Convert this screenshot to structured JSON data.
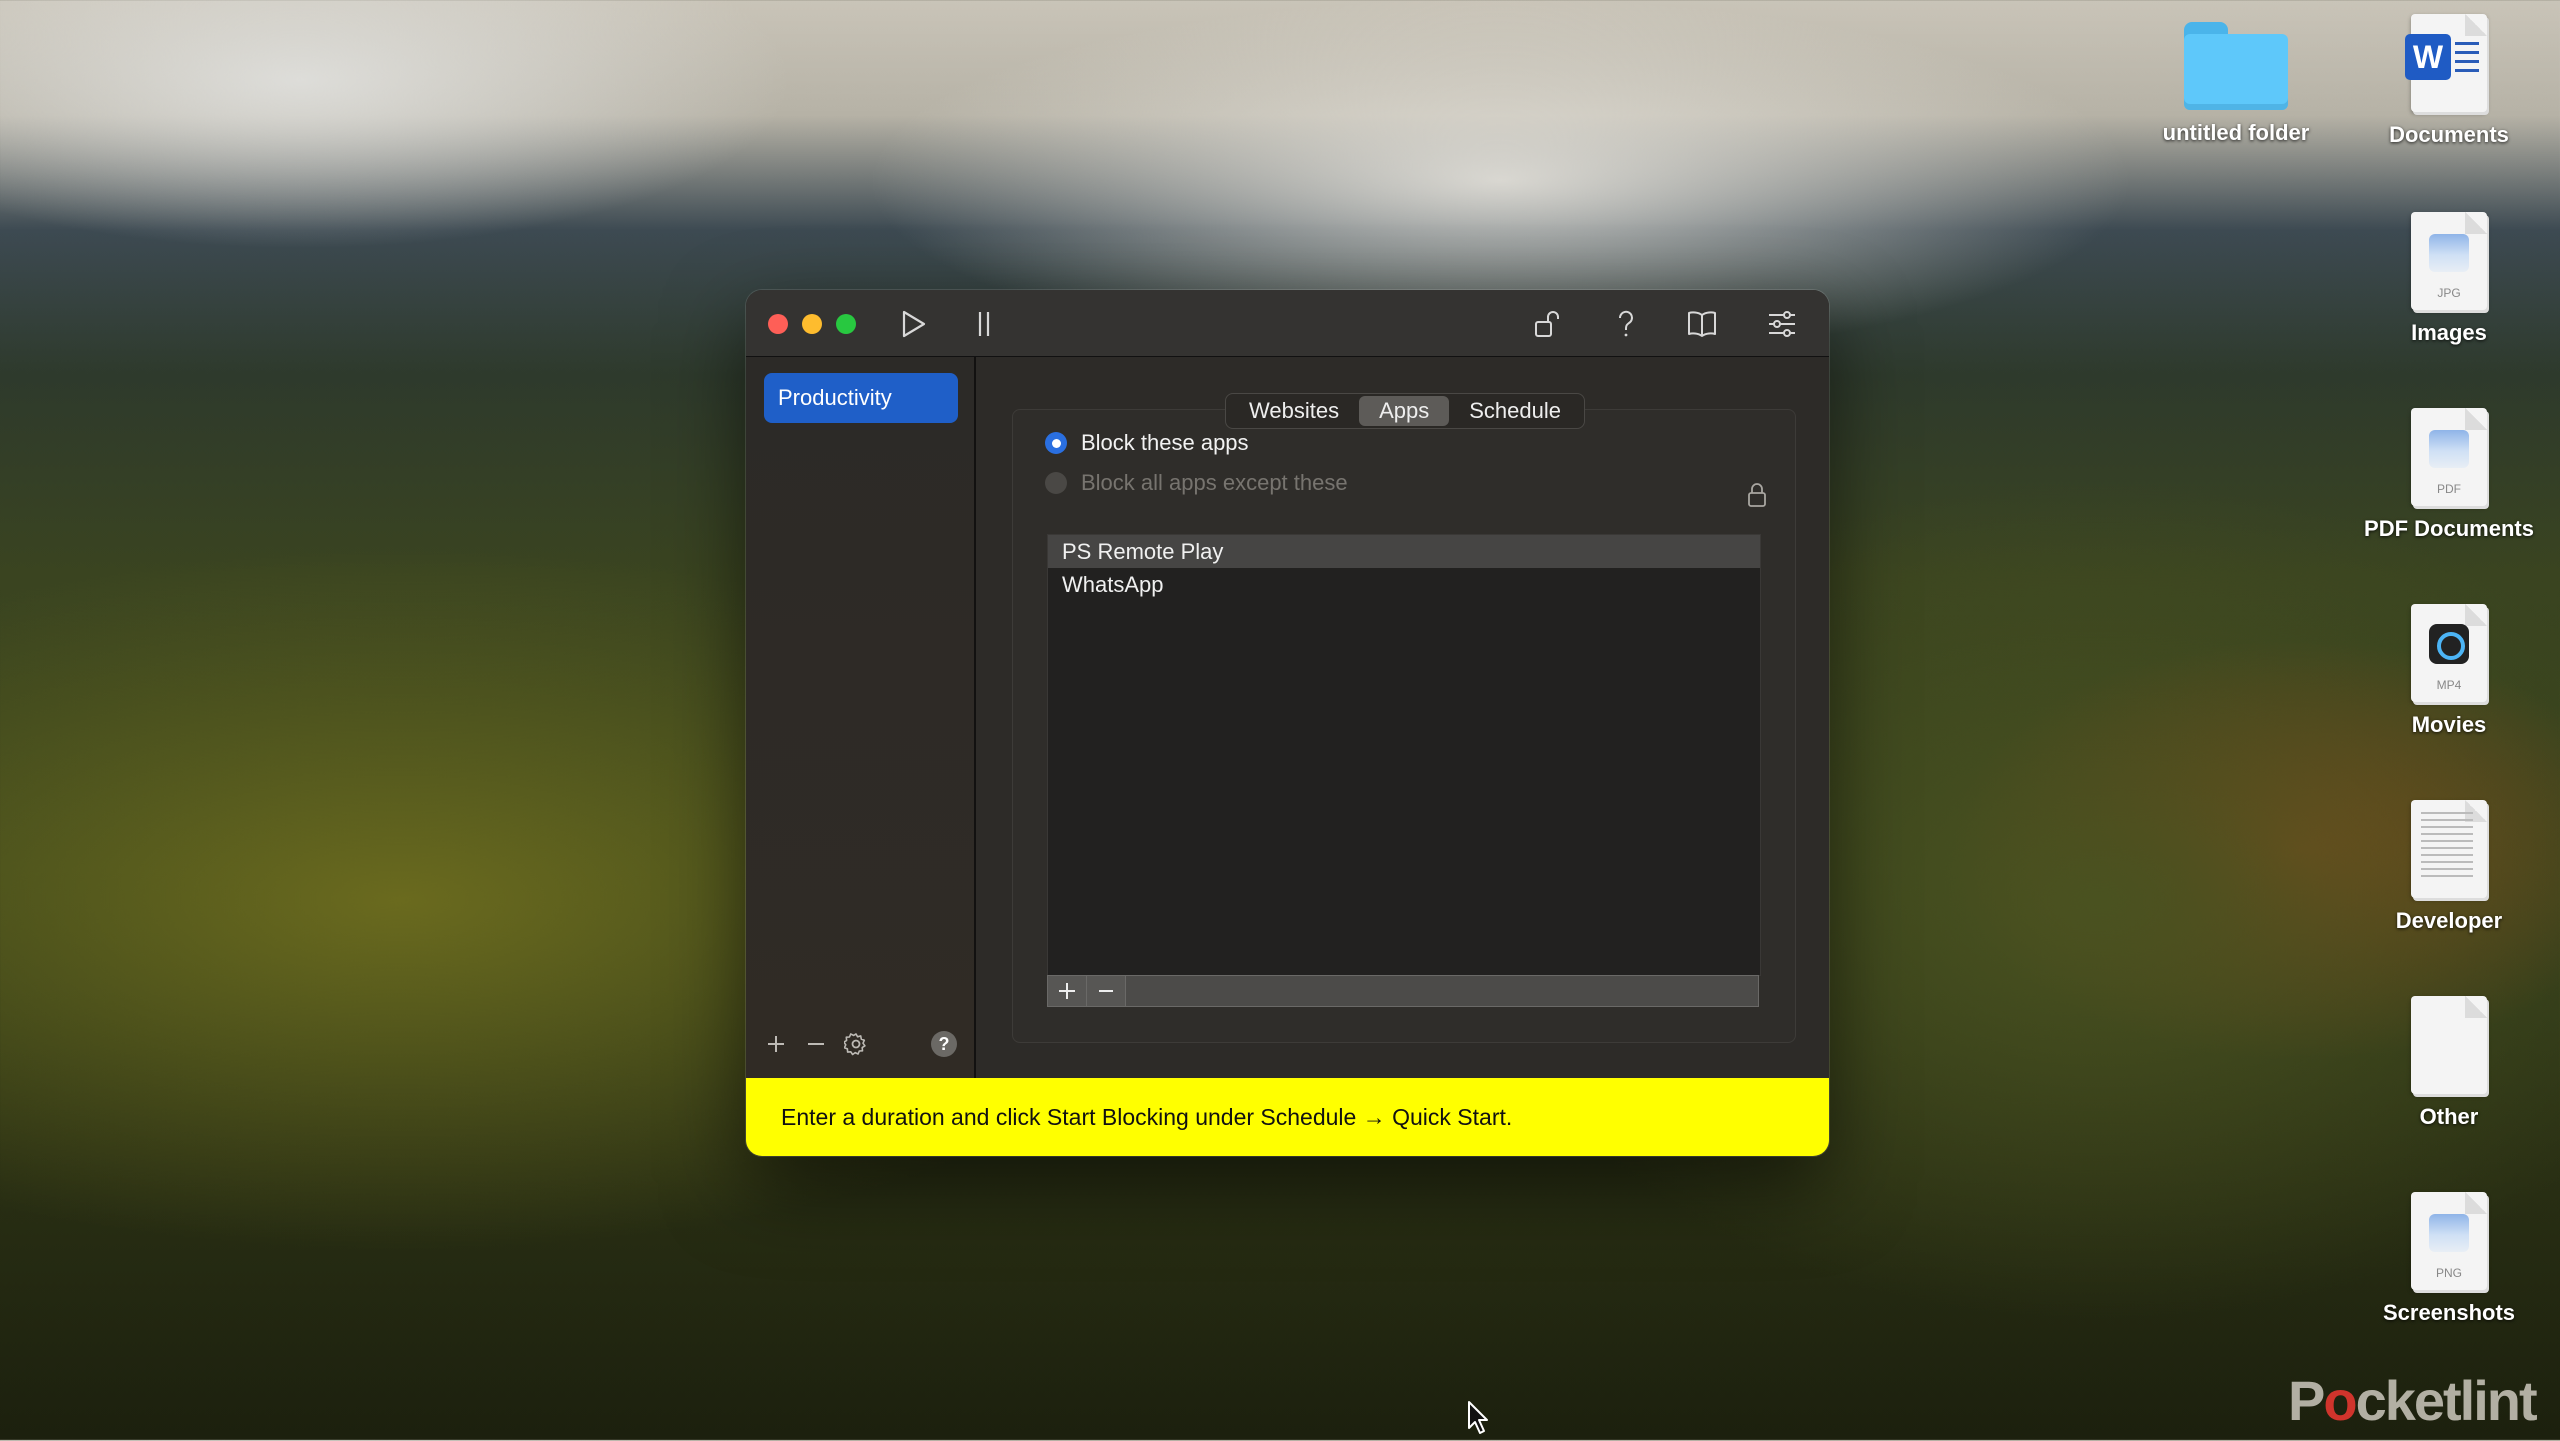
{
  "window": {
    "toolbar": {
      "play_label": "Start",
      "pause_label": "Pause"
    },
    "sidebar": {
      "items": [
        {
          "label": "Productivity",
          "selected": true
        }
      ],
      "bottom_help": "?"
    },
    "tabs": [
      {
        "label": "Websites",
        "active": false
      },
      {
        "label": "Apps",
        "active": true
      },
      {
        "label": "Schedule",
        "active": false
      }
    ],
    "mode": {
      "options": [
        {
          "label": "Block these apps",
          "selected": true,
          "enabled": true
        },
        {
          "label": "Block all apps except these",
          "selected": false,
          "enabled": false
        }
      ]
    },
    "apps_list": [
      {
        "name": "PS Remote Play",
        "selected": true
      },
      {
        "name": "WhatsApp",
        "selected": false
      }
    ],
    "list_toolbar": {
      "add": "+",
      "remove": "−"
    },
    "banner": "Enter a duration and click Start Blocking under Schedule → Quick Start.",
    "colors": {
      "accent": "#1f5fc8",
      "banner": "#ffff00"
    }
  },
  "desktop": {
    "icons": [
      {
        "label": "untitled folder",
        "kind": "folder"
      },
      {
        "label": "Documents",
        "kind": "word"
      },
      {
        "label": "Images",
        "kind": "file",
        "ext": "JPG"
      },
      {
        "label": "PDF Documents",
        "kind": "file",
        "ext": "PDF"
      },
      {
        "label": "Movies",
        "kind": "file",
        "ext": "MP4"
      },
      {
        "label": "Developer",
        "kind": "text"
      },
      {
        "label": "Other",
        "kind": "blank"
      },
      {
        "label": "Screenshots",
        "kind": "file",
        "ext": "PNG"
      }
    ],
    "watermark": {
      "prefix": "P",
      "o": "o",
      "suffix": "cketlint"
    }
  }
}
